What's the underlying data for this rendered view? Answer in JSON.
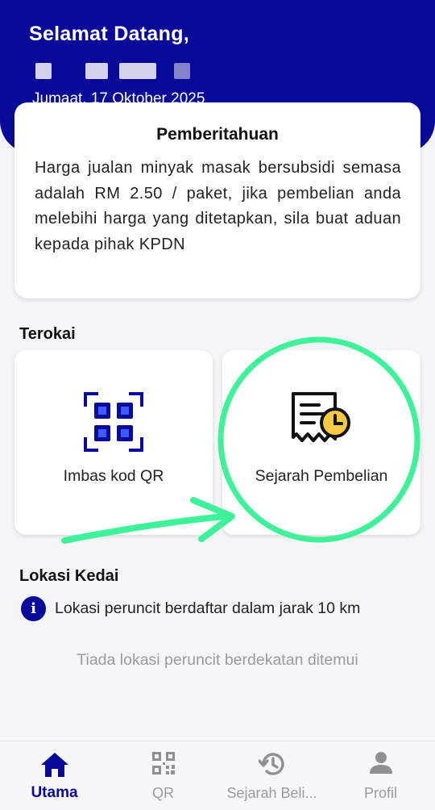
{
  "header": {
    "greeting": "Selamat Datang,",
    "date": "Jumaat, 17 Oktober 2025",
    "bg_color": "#0a0a9a"
  },
  "notice": {
    "title": "Pemberitahuan",
    "body": "Harga jualan minyak masak bersubsidi semasa adalah RM 2.50 / paket, jika pembelian anda melebihi harga yang ditetapkan, sila buat aduan kepada pihak KPDN"
  },
  "explore": {
    "title": "Terokai",
    "tiles": [
      {
        "label": "Imbas kod QR",
        "icon": "qr-scan-icon"
      },
      {
        "label": "Sejarah Pembelian",
        "icon": "receipt-clock-icon"
      }
    ]
  },
  "location": {
    "title": "Lokasi Kedai",
    "info_icon": "info-icon",
    "info_text": "Lokasi peruncit berdaftar dalam jarak 10 km",
    "empty_message": "Tiada lokasi peruncit berdekatan ditemui"
  },
  "annotation": {
    "highlight_color": "#3ef29a"
  },
  "bottom_nav": {
    "items": [
      {
        "label": "Utama",
        "icon": "home-icon",
        "active": true
      },
      {
        "label": "QR",
        "icon": "qr-icon",
        "active": false
      },
      {
        "label": "Sejarah Beli...",
        "icon": "history-icon",
        "active": false
      },
      {
        "label": "Profil",
        "icon": "person-icon",
        "active": false
      }
    ],
    "active_color": "#0a0a9a",
    "inactive_color": "#9a9aa0"
  }
}
